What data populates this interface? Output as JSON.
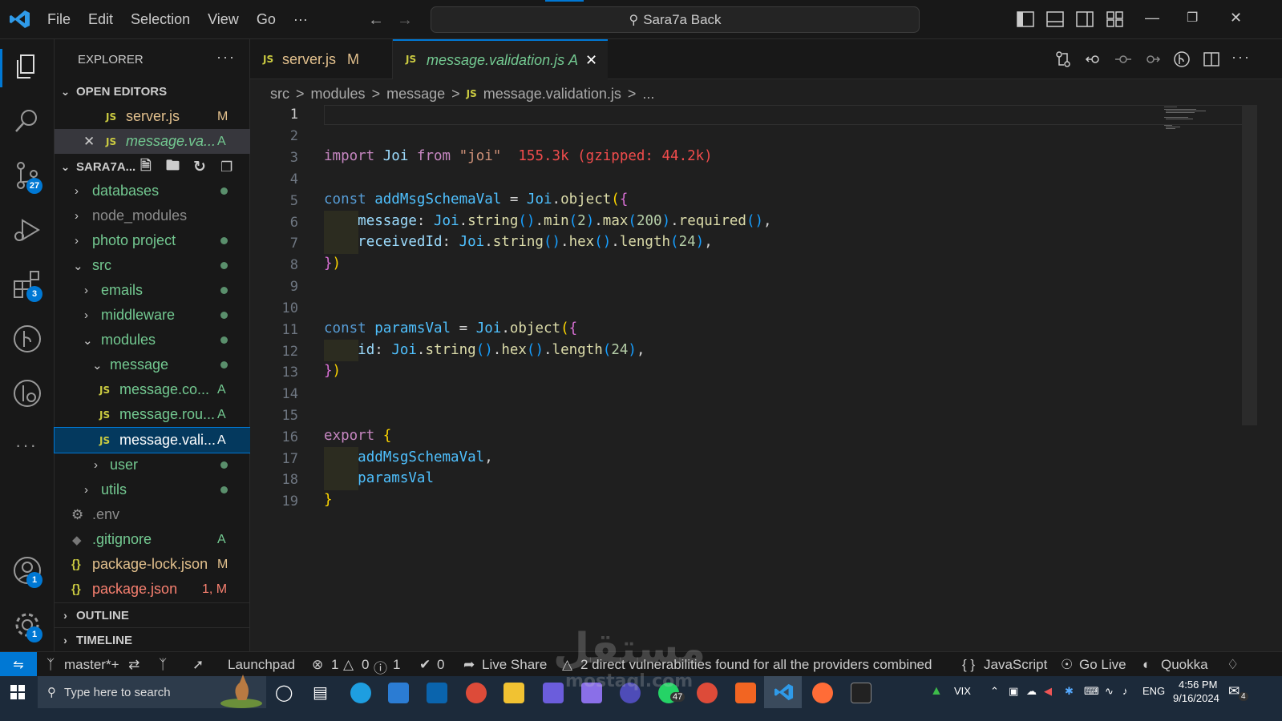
{
  "titlebar": {
    "menu": [
      "File",
      "Edit",
      "Selection",
      "View",
      "Go",
      "···"
    ],
    "search_text": "Sara7a Back"
  },
  "activity": {
    "scm_badge": "27",
    "extensions_badge": "3",
    "accounts_badge": "1",
    "settings_badge": "1"
  },
  "explorer": {
    "title": "EXPLORER",
    "more": "···",
    "open_editors_label": "OPEN EDITORS",
    "open_editors": [
      {
        "name": "server.js",
        "status": "M"
      },
      {
        "name": "message.va...",
        "status": "A"
      }
    ],
    "project_label": "SARA7A...",
    "tree": [
      {
        "name": "databases"
      },
      {
        "name": "node_modules"
      },
      {
        "name": "photo project"
      },
      {
        "name": "src"
      },
      {
        "name": "emails"
      },
      {
        "name": "middleware"
      },
      {
        "name": "modules"
      },
      {
        "name": "message"
      },
      {
        "name": "message.co...",
        "status": "A"
      },
      {
        "name": "message.rou...",
        "status": "A"
      },
      {
        "name": "message.vali...",
        "status": "A"
      },
      {
        "name": "user"
      },
      {
        "name": "utils"
      },
      {
        "name": ".env"
      },
      {
        "name": ".gitignore",
        "status": "A"
      },
      {
        "name": "package-lock.json",
        "status": "M"
      },
      {
        "name": "package.json",
        "status": "1, M"
      }
    ],
    "outline_label": "OUTLINE",
    "timeline_label": "TIMELINE"
  },
  "tabs": [
    {
      "name": "server.js",
      "status": "M"
    },
    {
      "name": "message.validation.js",
      "status": "A"
    }
  ],
  "breadcrumb": [
    "src",
    ">",
    "modules",
    ">",
    "message",
    ">",
    "message.validation.js",
    ">",
    "..."
  ],
  "editor": {
    "line_numbers": [
      "1",
      "2",
      "3",
      "4",
      "5",
      "6",
      "7",
      "8",
      "9",
      "10",
      "11",
      "12",
      "13",
      "14",
      "15",
      "16",
      "17",
      "18",
      "19"
    ],
    "import_hint": "155.3k (gzipped: 44.2k)",
    "code": {
      "l3a": "import",
      "l3b": "Joi",
      "l3c": "from",
      "l3d": "\"joi\"",
      "l5a": "const",
      "l5b": "addMsgSchemaVal",
      "l5c": "=",
      "l5d": "Joi",
      "l5e": "object",
      "l6a": "message",
      "l6b": "Joi",
      "l6c": "string",
      "l6d": "min",
      "l6e": "2",
      "l6f": "max",
      "l6g": "200",
      "l6h": "required",
      "l7a": "receivedId",
      "l7b": "Joi",
      "l7c": "string",
      "l7d": "hex",
      "l7e": "length",
      "l7f": "24",
      "l11a": "const",
      "l11b": "paramsVal",
      "l11c": "=",
      "l11d": "Joi",
      "l11e": "object",
      "l12a": "id",
      "l12b": "Joi",
      "l12c": "string",
      "l12d": "hex",
      "l12e": "length",
      "l12f": "24",
      "l16a": "export",
      "l17a": "addMsgSchemaVal",
      "l18a": "paramsVal"
    }
  },
  "status": {
    "branch": "master*+",
    "launchpad": "Launchpad",
    "errors": "1",
    "warnings": "0",
    "infos": "1",
    "ports": "0",
    "live_share": "Live Share",
    "vulnerabilities": "2 direct vulnerabilities found for all the providers combined",
    "language": "JavaScript",
    "go_live": "Go Live",
    "quokka": "Quokka"
  },
  "taskbar": {
    "search_placeholder": "Type here to search",
    "whatsapp_badge": "47",
    "stock": "VIX",
    "lang": "ENG",
    "time": "4:56 PM",
    "date": "9/16/2024",
    "notif": "4"
  },
  "watermark": {
    "main": "مستقل",
    "sub": "mostaql.com"
  }
}
